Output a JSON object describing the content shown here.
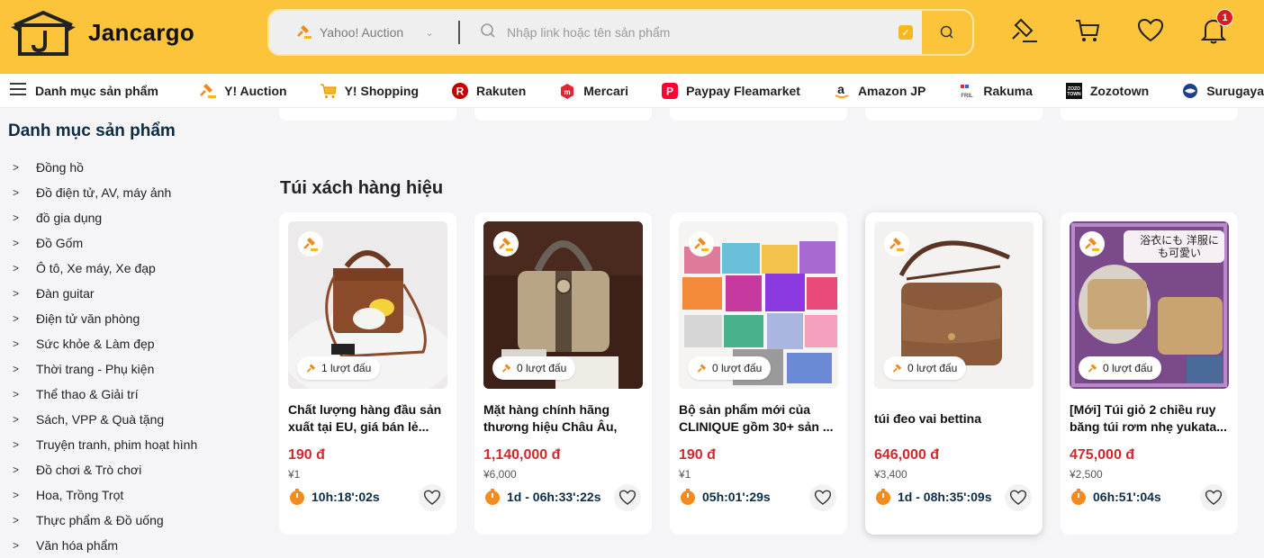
{
  "brand": {
    "name": "Jancargo",
    "accent": "#fcc43a"
  },
  "search": {
    "site": "Yahoo! Auction",
    "placeholder": "Nhập link hoặc tên sản phẩm"
  },
  "header": {
    "notifications_count": "1"
  },
  "nav": {
    "category_label": "Danh mục sản phẩm",
    "links": [
      {
        "label": "Y! Auction",
        "icon": "gavel-icon"
      },
      {
        "label": "Y! Shopping",
        "icon": "cart-icon"
      },
      {
        "label": "Rakuten",
        "icon": "rakuten-logo-icon"
      },
      {
        "label": "Mercari",
        "icon": "mercari-logo-icon"
      },
      {
        "label": "Paypay Fleamarket",
        "icon": "paypay-logo-icon"
      },
      {
        "label": "Amazon JP",
        "icon": "amazon-logo-icon"
      },
      {
        "label": "Rakuma",
        "icon": "rakuma-logo-icon"
      },
      {
        "label": "Zozotown",
        "icon": "zozotown-logo-icon"
      },
      {
        "label": "Surugaya",
        "icon": "surugaya-logo-icon"
      }
    ]
  },
  "sidebar": {
    "title": "Danh mục sản phẩm",
    "items": [
      "Đồng hồ",
      "Đồ điện tử, AV, máy ảnh",
      "đồ gia dụng",
      "Đồ Gốm",
      "Ô tô, Xe máy, Xe đạp",
      "Đàn guitar",
      "Điện tử văn phòng",
      "Sức khỏe & Làm đẹp",
      "Thời trang - Phụ kiện",
      "Thể thao & Giải trí",
      "Sách, VPP & Quà tặng",
      "Truyện tranh, phim hoạt hình",
      "Đồ chơi & Trò chơi",
      "Hoa, Trồng Trọt",
      "Thực phẩm & Đồ uống",
      "Văn hóa phẩm"
    ]
  },
  "section": {
    "title": "Túi xách hàng hiệu",
    "products": [
      {
        "bids": "1 lượt đấu",
        "title": "Chất lượng hàng đầu sản xuất tại EU, giá bán lẻ...",
        "price": "190 đ",
        "yen": "¥1",
        "timer": "10h:18':02s"
      },
      {
        "bids": "0 lượt đấu",
        "title": "Mặt hàng chính hãng thương hiệu Châu Âu, phẩ...",
        "price": "1,140,000 đ",
        "yen": "¥6,000",
        "timer": "1d - 06h:33':22s"
      },
      {
        "bids": "0 lượt đấu",
        "title": "Bộ sản phẩm mới của CLINIQUE gồm 30+ sản ...",
        "price": "190 đ",
        "yen": "¥1",
        "timer": "05h:01':29s"
      },
      {
        "bids": "0 lượt đấu",
        "title": "túi đeo vai bettina",
        "price": "646,000 đ",
        "yen": "¥3,400",
        "timer": "1d - 08h:35':09s"
      },
      {
        "bids": "0 lượt đấu",
        "title": "[Mới] Túi giỏ 2 chiều ruy băng túi rơm nhẹ yukata...",
        "price": "475,000 đ",
        "yen": "¥2,500",
        "timer": "06h:51':04s",
        "overlay_text": "浴衣にも 洋服にも可愛い"
      }
    ]
  }
}
